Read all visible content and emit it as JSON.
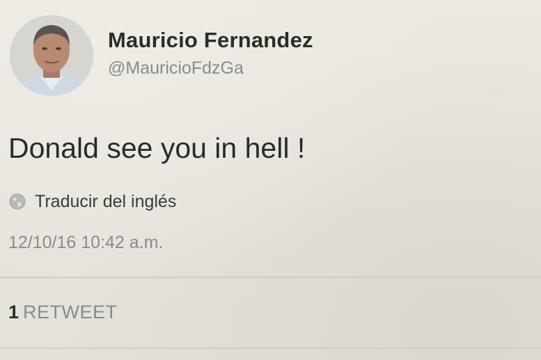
{
  "author": {
    "display_name": "Mauricio Fernandez",
    "handle": "@MauricioFdzGa",
    "avatar_icon": "profile-photo"
  },
  "tweet": {
    "text": "Donald see you in hell !",
    "translate_label": "Traducir del inglés",
    "translate_icon": "globe-icon",
    "timestamp": "12/10/16 10:42 a.m."
  },
  "stats": {
    "retweet_count": "1",
    "retweet_label": "RETWEET"
  },
  "colors": {
    "background": "#e7e5dd",
    "name_text": "#2c2c2c",
    "secondary_text": "#8a8a86",
    "divider": "#cfcdc5"
  }
}
